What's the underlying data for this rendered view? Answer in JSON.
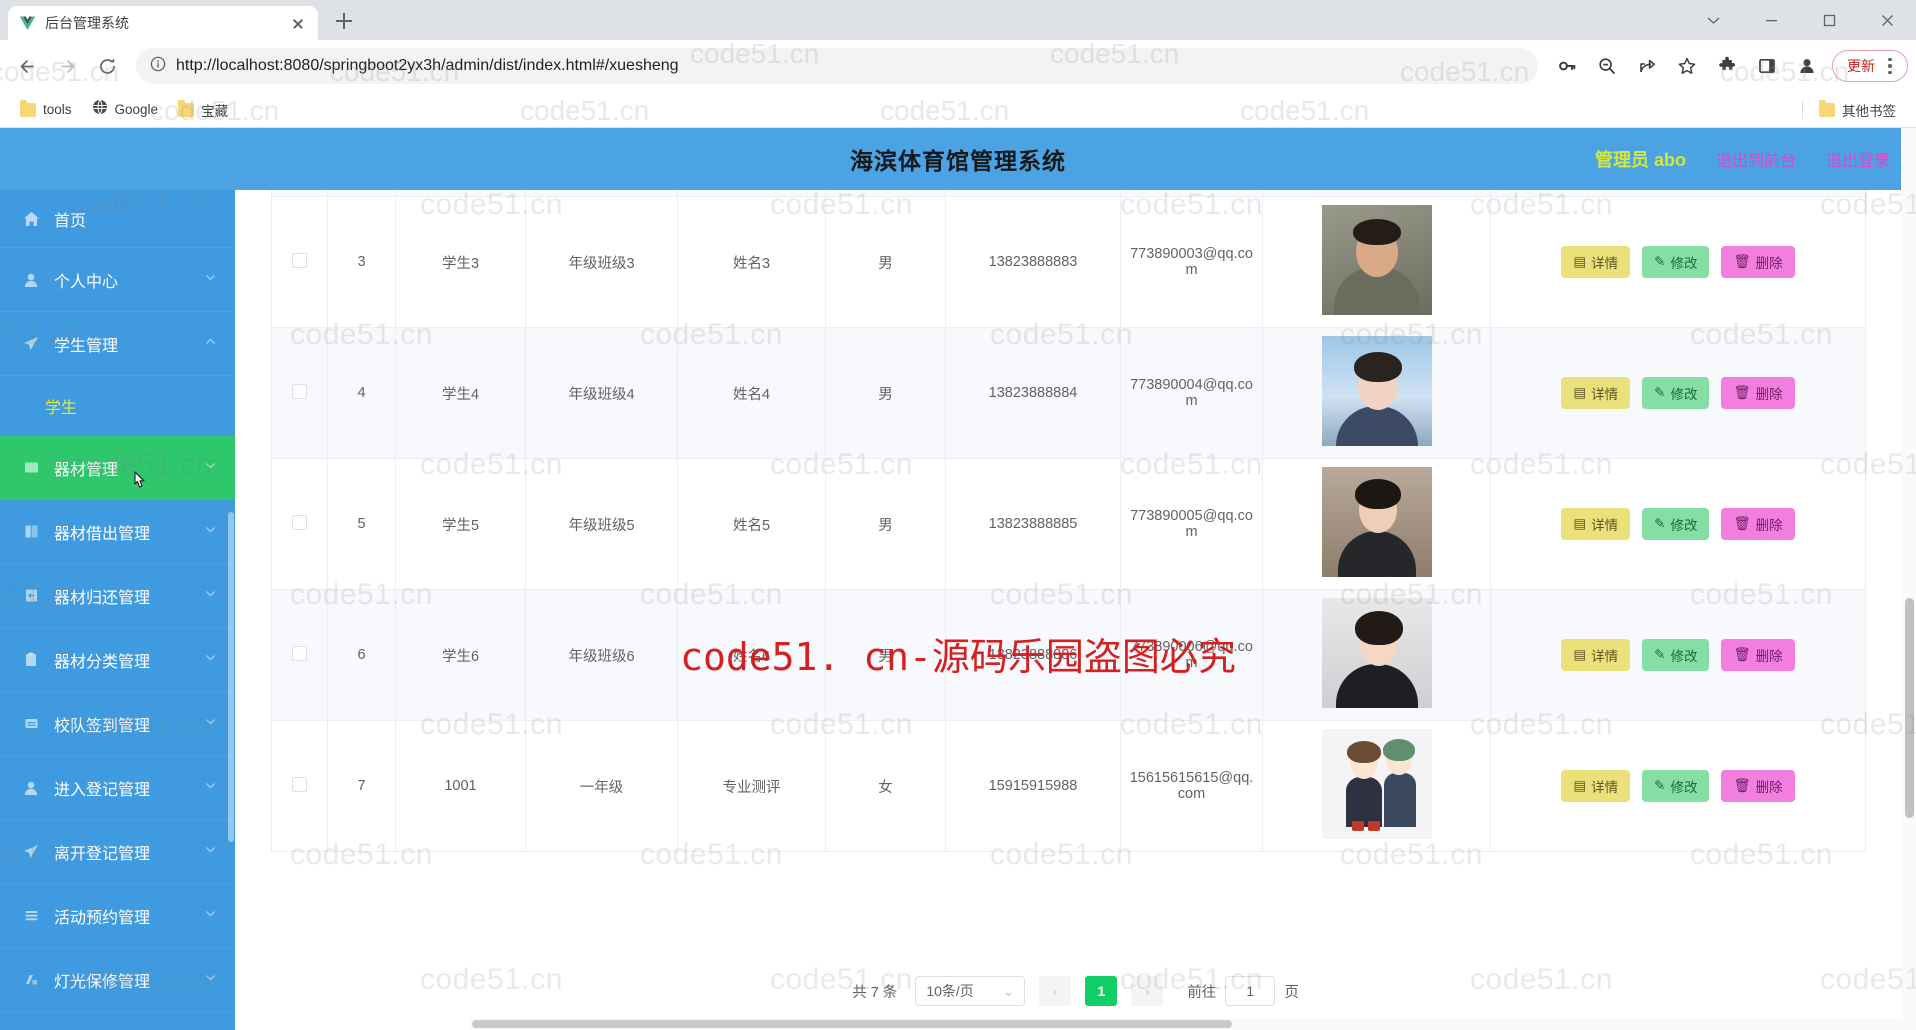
{
  "browser": {
    "tab": {
      "title": "后台管理系统",
      "favicon": "vue-logo-icon"
    },
    "new_tab_label": "+",
    "url": "http://localhost:8080/springboot2yx3h/admin/dist/index.html#/xuesheng",
    "toolbar_icons": [
      "back-icon",
      "forward-icon",
      "reload-icon",
      "site-info-icon",
      "password-key-icon",
      "zoom-out-icon",
      "share-icon",
      "bookmark-star-icon",
      "extensions-puzzle-icon",
      "side-panel-icon",
      "profile-avatar-icon"
    ],
    "update_button": "更新",
    "bookmarks": [
      {
        "label": "tools",
        "icon": "folder-icon"
      },
      {
        "label": "Google",
        "icon": "globe-icon"
      },
      {
        "label": "宝藏",
        "icon": "folder-icon"
      }
    ],
    "other_bookmarks": {
      "label": "其他书签",
      "icon": "folder-icon"
    },
    "window_controls": [
      "minimize-tray-icon",
      "minimize-icon",
      "maximize-icon",
      "close-icon"
    ]
  },
  "app": {
    "title": "海滨体育馆管理系统",
    "header": {
      "user_label": "管理员 abo",
      "links": [
        "退出到前台",
        "退出登录"
      ],
      "user_color": "#d4e83a",
      "link_color": "#e840c8",
      "bg_color": "#4ba3e3"
    },
    "sidebar": {
      "items": [
        {
          "label": "首页",
          "icon": "home-icon",
          "state": "normal",
          "has_chevron": false
        },
        {
          "label": "个人中心",
          "icon": "user-icon",
          "state": "normal",
          "has_chevron": true
        },
        {
          "label": "学生管理",
          "icon": "send-icon",
          "state": "expanded",
          "has_chevron": true
        },
        {
          "label": "学生",
          "icon": "",
          "state": "sub-active",
          "has_chevron": false
        },
        {
          "label": "器材管理",
          "icon": "box-icon",
          "state": "hover",
          "has_chevron": true
        },
        {
          "label": "器材借出管理",
          "icon": "book-icon",
          "state": "normal",
          "has_chevron": true
        },
        {
          "label": "器材归还管理",
          "icon": "return-icon",
          "state": "normal",
          "has_chevron": true
        },
        {
          "label": "器材分类管理",
          "icon": "clipboard-icon",
          "state": "normal",
          "has_chevron": true
        },
        {
          "label": "校队签到管理",
          "icon": "note-icon",
          "state": "normal",
          "has_chevron": true
        },
        {
          "label": "进入登记管理",
          "icon": "user-icon",
          "state": "normal",
          "has_chevron": true
        },
        {
          "label": "离开登记管理",
          "icon": "send-icon",
          "state": "normal",
          "has_chevron": true
        },
        {
          "label": "活动预约管理",
          "icon": "list-icon",
          "state": "normal",
          "has_chevron": true
        },
        {
          "label": "灯光保修管理",
          "icon": "lamp-icon",
          "state": "normal",
          "has_chevron": true
        }
      ],
      "active_sub_color": "#e8e83c",
      "hover_color": "#2ec76c",
      "bg_color": "#3f9ae0"
    },
    "table": {
      "rows": [
        {
          "index": "3",
          "student_id": "学生3",
          "grade_class": "年级班级3",
          "name": "姓名3",
          "gender": "男",
          "phone": "13823888883",
          "email": "773890003@qq.com",
          "avatar": "male-portrait"
        },
        {
          "index": "4",
          "student_id": "学生4",
          "grade_class": "年级班级4",
          "name": "姓名4",
          "gender": "男",
          "phone": "13823888884",
          "email": "773890004@qq.com",
          "avatar": "female-portrait-sky"
        },
        {
          "index": "5",
          "student_id": "学生5",
          "grade_class": "年级班级5",
          "name": "姓名5",
          "gender": "男",
          "phone": "13823888885",
          "email": "773890005@qq.com",
          "avatar": "female-portrait-dark"
        },
        {
          "index": "6",
          "student_id": "学生6",
          "grade_class": "年级班级6",
          "name": "姓名6",
          "gender": "男",
          "phone": "13823888886",
          "email": "773890006@qq.com",
          "avatar": "female-portrait-white"
        },
        {
          "index": "7",
          "student_id": "1001",
          "grade_class": "一年级",
          "name": "专业测评",
          "gender": "女",
          "phone": "15915915988",
          "email": "15615615615@qq.com",
          "avatar": "anime-illustration"
        }
      ],
      "actions": {
        "detail": {
          "label": "详情",
          "icon": "document-icon",
          "color": "#ebe17a"
        },
        "edit": {
          "label": "修改",
          "icon": "pencil-icon",
          "color": "#85dfa5"
        },
        "delete": {
          "label": "删除",
          "icon": "trash-icon",
          "color": "#f27fe0"
        }
      }
    },
    "pagination": {
      "total_label": "共 7 条",
      "page_size": "10条/页",
      "prev_icon": "chevron-left-icon",
      "next_icon": "chevron-right-icon",
      "current_page": "1",
      "jump_prefix": "前往",
      "jump_value": "1",
      "jump_suffix": "页",
      "active_color": "#13ce66"
    }
  },
  "watermarks": {
    "tile_text": "code51.cn",
    "red_text": "code51. cn-源码乐园盗图必究",
    "red_color": "#d62020"
  }
}
